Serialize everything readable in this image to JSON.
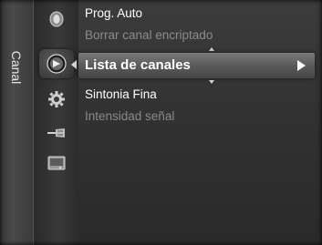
{
  "side_tab": {
    "label": "Canal"
  },
  "icons": [
    {
      "name": "picture-icon"
    },
    {
      "name": "channel-icon",
      "active": true
    },
    {
      "name": "setup-gear-icon"
    },
    {
      "name": "input-icon"
    },
    {
      "name": "application-icon"
    }
  ],
  "menu": {
    "items": [
      {
        "label": "Prog. Auto",
        "state": "enabled"
      },
      {
        "label": "Borrar canal encriptado",
        "state": "disabled"
      },
      {
        "label": "Lista de canales",
        "state": "selected"
      },
      {
        "label": "Sintonia Fina",
        "state": "enabled"
      },
      {
        "label": "Intensidad señal",
        "state": "disabled"
      }
    ]
  },
  "colors": {
    "panel_bg": "#333333",
    "disabled_text": "#8a8a8a",
    "enabled_text": "#ffffff",
    "selected_bar": "#5a5a5a"
  }
}
